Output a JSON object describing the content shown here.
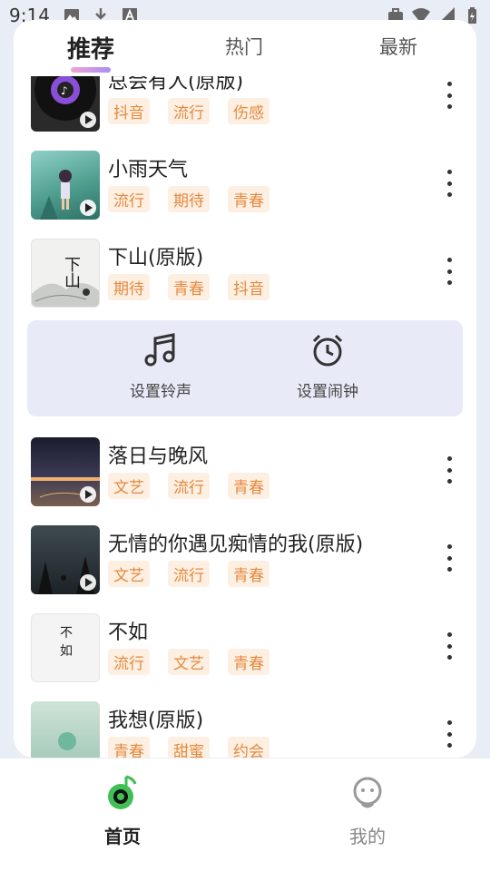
{
  "status_bar": {
    "time": "9:14"
  },
  "tabs": [
    {
      "label": "推荐",
      "active": true
    },
    {
      "label": "热门",
      "active": false
    },
    {
      "label": "最新",
      "active": false
    }
  ],
  "songs_top": [
    {
      "title": "总会有人(原版)",
      "tags": [
        "抖音",
        "流行",
        "伤感"
      ]
    },
    {
      "title": "小雨天气",
      "tags": [
        "流行",
        "期待",
        "青春"
      ]
    },
    {
      "title": "下山(原版)",
      "tags": [
        "期待",
        "青春",
        "抖音"
      ]
    }
  ],
  "actions": {
    "ringtone": "设置铃声",
    "alarm": "设置闹钟"
  },
  "songs_bottom": [
    {
      "title": "落日与晚风",
      "tags": [
        "文艺",
        "流行",
        "青春"
      ]
    },
    {
      "title": "无情的你遇见痴情的我(原版)",
      "tags": [
        "文艺",
        "流行",
        "青春"
      ]
    },
    {
      "title": "不如",
      "tags": [
        "流行",
        "文艺",
        "青春"
      ]
    },
    {
      "title": "我想(原版)",
      "tags": [
        "青春",
        "甜蜜",
        "约会"
      ]
    }
  ],
  "cover_texts": {
    "buru_top": "不",
    "buru_bottom": "如",
    "xiashan": "下山"
  },
  "bottom_nav": {
    "home": "首页",
    "mine": "我的"
  },
  "colors": {
    "tag_text": "#e5893d",
    "tag_bg": "#fdf0e3",
    "accent_green": "#3fbf55",
    "action_bg": "#e8ebf7"
  }
}
